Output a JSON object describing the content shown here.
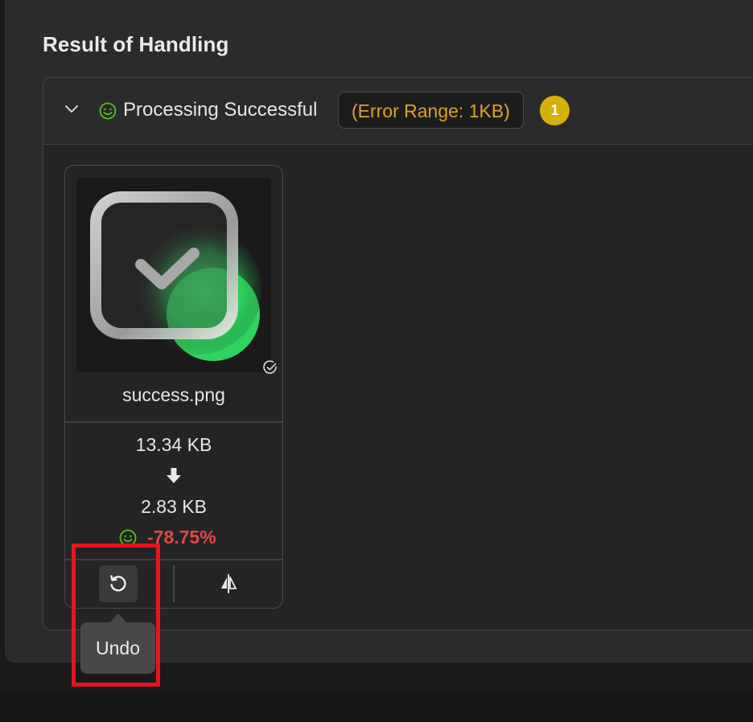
{
  "dialog": {
    "title": "Result of Handling"
  },
  "group": {
    "status": "Processing Successful",
    "error_range": "(Error Range: 1KB)",
    "count": "1"
  },
  "file_card": {
    "filename": "success.png",
    "original_size": "13.34 KB",
    "compressed_size": "2.83 KB",
    "saving": "-78.75%"
  },
  "tooltip": {
    "text": "Undo"
  },
  "colors": {
    "success_green": "#52c41a",
    "warning_orange": "#e0a030",
    "badge_yellow": "#d4b106",
    "saving_red": "#e04848",
    "highlight_red": "#e8141e"
  },
  "icons": {
    "collapse": "chevron-down-icon",
    "status": "smile-icon",
    "arrow": "arrow-down-icon",
    "undo": "undo-icon",
    "compare": "compare-icon",
    "selected": "check-circle-icon"
  }
}
